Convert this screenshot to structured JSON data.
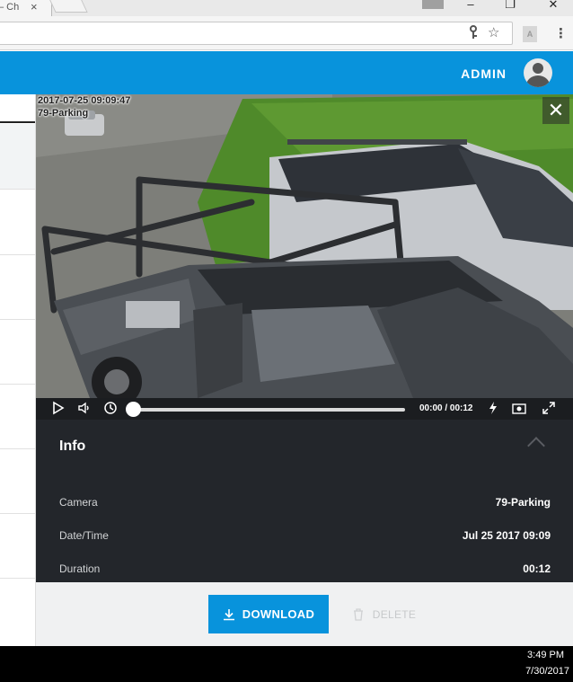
{
  "browser": {
    "tab_title": "– Ch",
    "tab_close": "×",
    "window_controls": {
      "minimize": "–",
      "maximize": "❐",
      "close": "✕"
    },
    "toolbar_icons": [
      "key-icon",
      "star-icon",
      "pdf-extension-icon",
      "menu-icon"
    ]
  },
  "header": {
    "user_label": "ADMIN",
    "avatar_icon": "user-avatar-icon",
    "brand_color": "#0893dc"
  },
  "video": {
    "overlay_timestamp": "2017-07-25 09:09:47",
    "overlay_camera": "79-Parking",
    "close_icon": "close-icon"
  },
  "player": {
    "time_display": "00:00 / 00:12",
    "progress": 0,
    "icons": [
      "play-icon",
      "volume-icon",
      "clock-icon",
      "lightning-icon",
      "snapshot-icon",
      "fullscreen-icon"
    ]
  },
  "info": {
    "title": "Info",
    "fields": [
      {
        "label": "Camera",
        "value": "79-Parking"
      },
      {
        "label": "Date/Time",
        "value": "Jul 25 2017 09:09"
      },
      {
        "label": "Duration",
        "value": "00:12"
      }
    ]
  },
  "actions": {
    "download_label": "DOWNLOAD",
    "delete_label": "DELETE"
  },
  "taskbar": {
    "time": "3:49 PM",
    "date": "7/30/2017"
  }
}
